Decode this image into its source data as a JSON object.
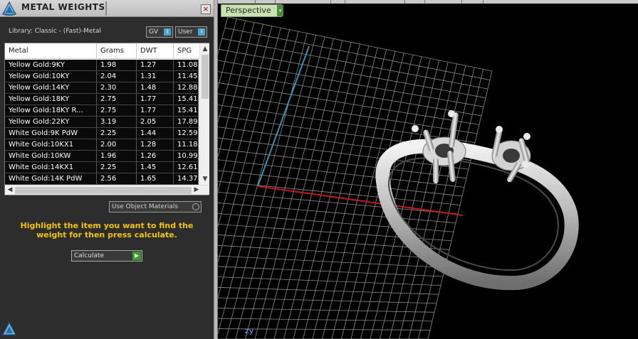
{
  "panel": {
    "title": "METAL WEIGHTS",
    "close_glyph": "×",
    "library_label": "Library: Classic - (Fast)-Metal",
    "toggle_gv": "GV",
    "toggle_user": "User",
    "toggle_knob": "I",
    "columns": [
      "Metal",
      "Grams",
      "DWT",
      "SPG"
    ],
    "rows": [
      {
        "metal": "Yellow Gold:9KY",
        "grams": "1.98",
        "dwt": "1.27",
        "spg": "11.08"
      },
      {
        "metal": "Yellow Gold:10KY",
        "grams": "2.04",
        "dwt": "1.31",
        "spg": "11.45"
      },
      {
        "metal": "Yellow Gold:14KY",
        "grams": "2.30",
        "dwt": "1.48",
        "spg": "12.88"
      },
      {
        "metal": "Yellow Gold:18KY",
        "grams": "2.75",
        "dwt": "1.77",
        "spg": "15.41"
      },
      {
        "metal": "Yellow Gold:18KY R...",
        "grams": "2.75",
        "dwt": "1.77",
        "spg": "15.41"
      },
      {
        "metal": "Yellow Gold:22KY",
        "grams": "3.19",
        "dwt": "2.05",
        "spg": "17.89"
      },
      {
        "metal": "White Gold:9K PdW",
        "grams": "2.25",
        "dwt": "1.44",
        "spg": "12.59"
      },
      {
        "metal": "White Gold:10KX1",
        "grams": "2.00",
        "dwt": "1.28",
        "spg": "11.18"
      },
      {
        "metal": "White Gold:10KW",
        "grams": "1.96",
        "dwt": "1.26",
        "spg": "10.99"
      },
      {
        "metal": "White Gold:14KX1",
        "grams": "2.25",
        "dwt": "1.45",
        "spg": "12.61"
      },
      {
        "metal": "White Gold:14K PdW",
        "grams": "2.56",
        "dwt": "1.65",
        "spg": "14.37"
      }
    ],
    "use_object_materials": "Use Object Materials",
    "instruction": "Highlight the item you want to find the weight for then press calculate.",
    "calculate_label": "Calculate",
    "scroll_up": "▲",
    "scroll_down": "▼",
    "scroll_left": "◀",
    "scroll_right": "▶",
    "calculate_go": "▶"
  },
  "viewport": {
    "label": "Perspective",
    "dropdown_glyph": "▾",
    "axis_indicator": "zy"
  },
  "colors": {
    "instruction_text": "#f2c500",
    "grid_line": "#8a8a8a",
    "axis_x": "#c21d1d",
    "axis_y": "#3b8fb5",
    "viewport_label_bg": "#c8e0b4"
  },
  "icons": {
    "app_logo": "triangle-app-logo-icon",
    "close": "close-icon",
    "calculate_go": "play-arrow-icon"
  }
}
